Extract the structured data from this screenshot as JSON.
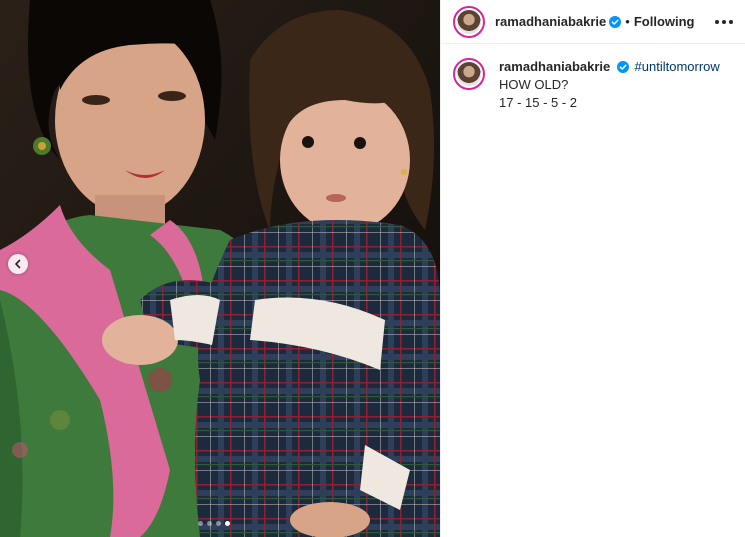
{
  "post": {
    "username": "ramadhaniabakrie",
    "follow_state": "Following",
    "separator": "•",
    "caption": {
      "hashtag": "#untiltomorrow",
      "lines": [
        "HOW OLD?",
        "17 - 15 - 5 - 2"
      ]
    },
    "carousel": {
      "total": 4,
      "active_index": 3
    }
  },
  "icons": {
    "verified": "verified-badge-icon",
    "more": "more-options-icon",
    "prev": "chevron-left-icon"
  },
  "colors": {
    "verified": "#0095f6",
    "avatar_ring": "#d6249f",
    "hashtag": "#00376b"
  }
}
